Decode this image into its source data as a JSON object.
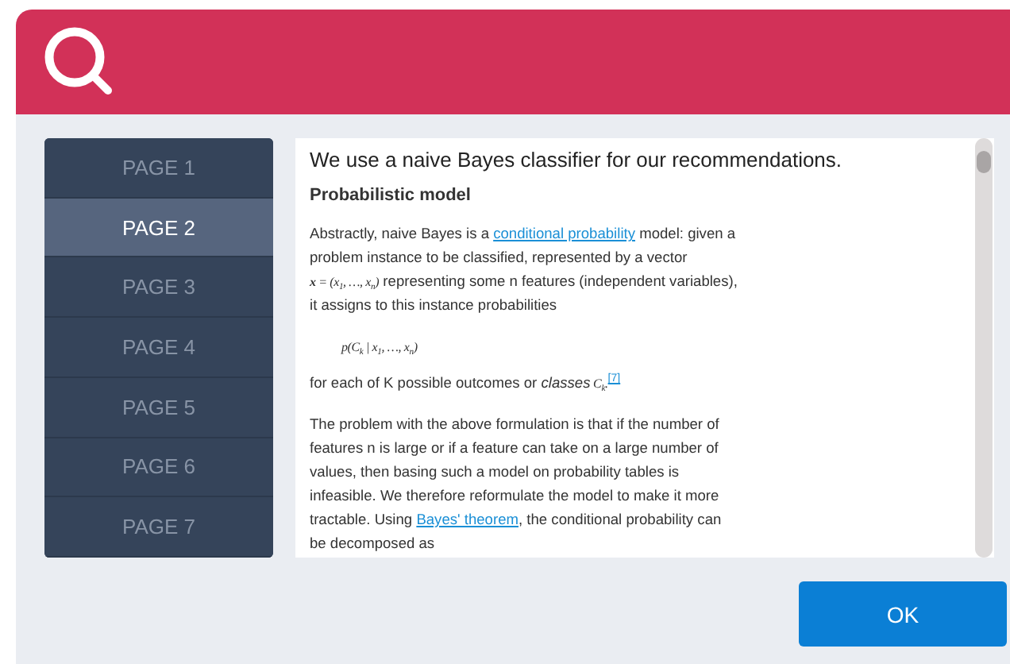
{
  "pages": [
    {
      "label": "PAGE 1",
      "selected": false
    },
    {
      "label": "PAGE 2",
      "selected": true
    },
    {
      "label": "PAGE 3",
      "selected": false
    },
    {
      "label": "PAGE 4",
      "selected": false
    },
    {
      "label": "PAGE 5",
      "selected": false
    },
    {
      "label": "PAGE 6",
      "selected": false
    },
    {
      "label": "PAGE 7",
      "selected": false
    }
  ],
  "article": {
    "intro": "We use a naive Bayes classifier for our recommendations.",
    "heading": "Probabilistic model",
    "blocks": [
      {
        "kind": "para",
        "segments": [
          {
            "kind": "text",
            "text": "Abstractly, naive Bayes is a "
          },
          {
            "kind": "link",
            "text": "conditional probability"
          },
          {
            "kind": "text",
            "text": " model: given a problem instance to be classified, represented by a vector "
          },
          {
            "kind": "math",
            "text": "**x** = (x$_{1}$, …, x$_{n}$)"
          },
          {
            "kind": "text",
            "text": " representing some n features (independent variables), it assigns to this instance probabilities"
          }
        ]
      },
      {
        "kind": "formula",
        "segments": [
          {
            "kind": "math",
            "text": "p(C$_{k}$ | x$_{1}$, …, x$_{n}$)"
          }
        ]
      },
      {
        "kind": "para",
        "segments": [
          {
            "kind": "text",
            "text": "for each of K possible outcomes or "
          },
          {
            "kind": "em",
            "text": "classes"
          },
          {
            "kind": "math",
            "text": " C$_{k}$."
          },
          {
            "kind": "ref",
            "text": "[7]"
          }
        ]
      },
      {
        "kind": "para",
        "segments": [
          {
            "kind": "text",
            "text": "The problem with the above formulation is that if the number of features n is large or if a feature can take on a large number of values, then basing such a model on probability tables is infeasible. We therefore reformulate the model to make it more tractable. Using "
          },
          {
            "kind": "link",
            "text": "Bayes' theorem"
          },
          {
            "kind": "text",
            "text": ", the conditional probability can be decomposed as"
          }
        ]
      }
    ]
  },
  "ok_button": "OK"
}
